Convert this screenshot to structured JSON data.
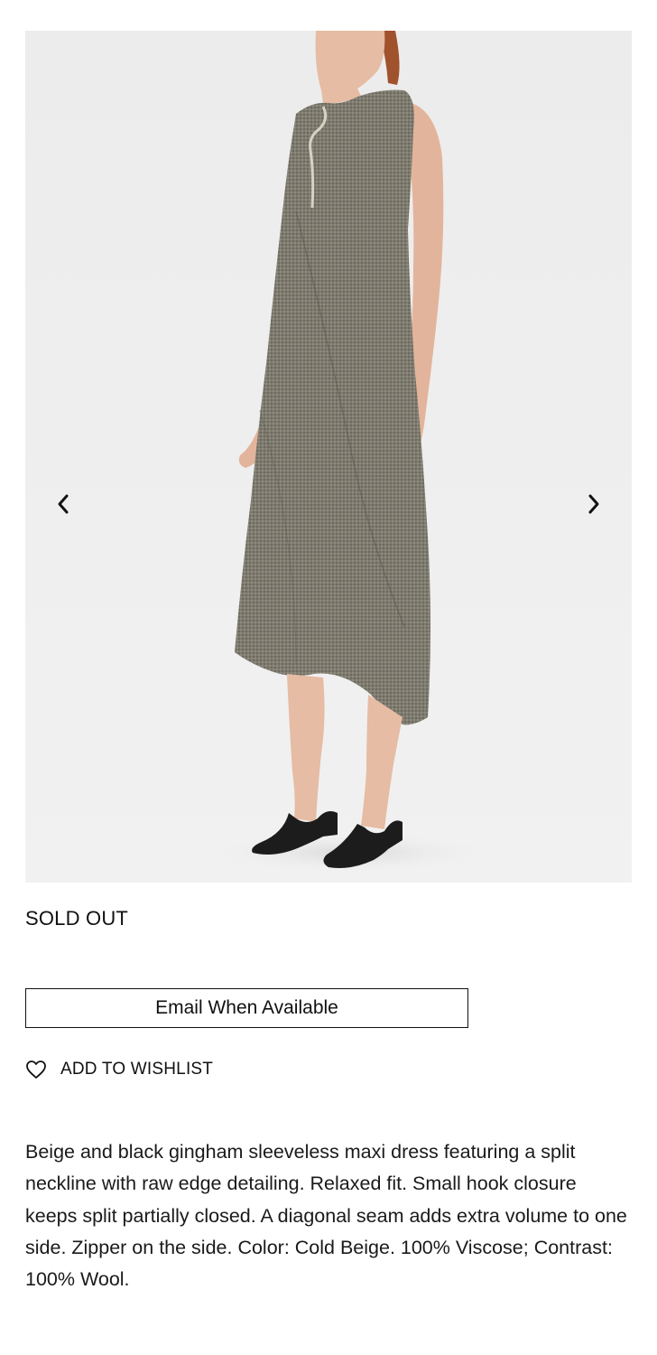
{
  "product": {
    "image": {
      "alt_icon": "product-photo",
      "prev_icon": "chevron-left-icon",
      "next_icon": "chevron-right-icon"
    },
    "status": "SOLD OUT",
    "email_button_label": "Email When Available",
    "wishlist": {
      "icon": "heart-icon",
      "label": "ADD TO WISHLIST"
    },
    "description": "Beige and black gingham sleeveless maxi dress featuring a split neckline with raw edge detailing. Relaxed fit. Small hook closure keeps split partially closed. A diagonal seam adds extra volume to one side. Zipper on the side. Color: Cold Beige. 100% Viscose; Contrast: 100% Wool."
  },
  "colors": {
    "background": "#ffffff",
    "text": "#111111",
    "dress": "#7a776b",
    "photo_bg": "#eeeeee"
  }
}
